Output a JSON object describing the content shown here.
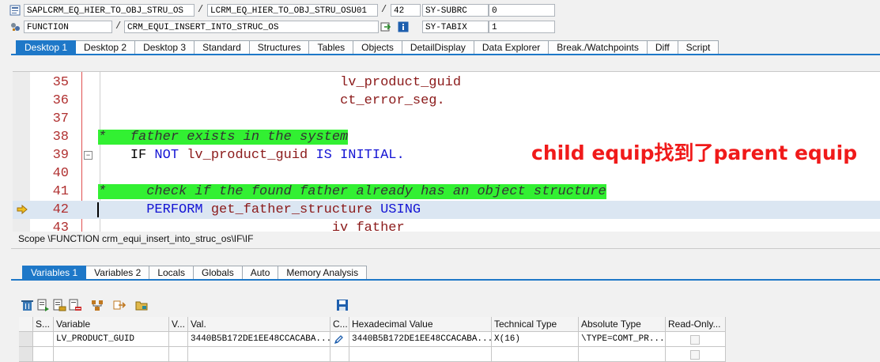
{
  "header": {
    "program": "SAPLCRM_EQ_HIER_TO_OBJ_STRU_OS",
    "include": "LCRM_EQ_HIER_TO_OBJ_STRU_OSU01",
    "line": "42",
    "sys_field_1": "SY-SUBRC",
    "sys_value_1": "0",
    "event_type": "FUNCTION",
    "event_name": "CRM_EQUI_INSERT_INTO_STRUC_OS",
    "sys_field_2": "SY-TABIX",
    "sys_value_2": "1",
    "separator": "/"
  },
  "main_tabs": [
    {
      "label": "Desktop 1",
      "active": true
    },
    {
      "label": "Desktop 2"
    },
    {
      "label": "Desktop 3"
    },
    {
      "label": "Standard"
    },
    {
      "label": "Structures"
    },
    {
      "label": "Tables"
    },
    {
      "label": "Objects"
    },
    {
      "label": "DetailDisplay"
    },
    {
      "label": "Data Explorer"
    },
    {
      "label": "Break./Watchpoints"
    },
    {
      "label": "Diff"
    },
    {
      "label": "Script"
    }
  ],
  "code_lines": [
    {
      "num": "35",
      "indent": "                              ",
      "text": "lv_product_guid",
      "style": "var"
    },
    {
      "num": "36",
      "indent": "                              ",
      "text": "ct_error_seg.",
      "style": "var"
    },
    {
      "num": "37",
      "indent": "",
      "text": "",
      "style": "normal"
    },
    {
      "num": "38",
      "indent": "",
      "text": "*   father exists in the system",
      "style": "comment"
    },
    {
      "num": "39",
      "indent": "",
      "text": "",
      "style": "if"
    },
    {
      "num": "40",
      "indent": "",
      "text": "",
      "style": "normal"
    },
    {
      "num": "41",
      "indent": "",
      "text": "*     check if the found father already has an object structure",
      "style": "comment"
    },
    {
      "num": "42",
      "indent": "",
      "text": "",
      "style": "perform"
    },
    {
      "num": "43",
      "indent": "                             ",
      "text": "iv_father",
      "style": "var"
    }
  ],
  "if_line": {
    "indent": "    ",
    "kw1": "IF NOT",
    "var": "lv_product_guid",
    "kw2": "IS INITIAL."
  },
  "perform_line": {
    "indent": "      ",
    "kw1": "PERFORM",
    "name": "get_father_structure",
    "kw2": "USING"
  },
  "annotation": "child equip找到了parent equip",
  "scope": "Scope \\FUNCTION crm_equi_insert_into_struc_os\\IF\\IF",
  "variable_tabs": [
    {
      "label": "Variables 1",
      "active": true
    },
    {
      "label": "Variables 2"
    },
    {
      "label": "Locals"
    },
    {
      "label": "Globals"
    },
    {
      "label": "Auto"
    },
    {
      "label": "Memory Analysis"
    }
  ],
  "grid": {
    "headers": [
      "",
      "S...",
      "Variable",
      "V...",
      "Val.",
      "C...",
      "Hexadecimal Value",
      "Technical Type",
      "Absolute Type",
      "Read-Only..."
    ],
    "rows": [
      {
        "variable": "LV_PRODUCT_GUID",
        "v": "",
        "value": "3440B5B172DE1EE48CCACABA...",
        "hex": "3440B5B172DE1EE48CCACABA...",
        "technical_type": "X(16)",
        "absolute_type": "\\TYPE=COMT_PR..."
      }
    ]
  },
  "colors": {
    "accent": "#1e78c8",
    "keyword": "#1414d4",
    "variable": "#8b1a1a",
    "comment_bg": "#32f032",
    "annotation": "#f01a1a"
  }
}
